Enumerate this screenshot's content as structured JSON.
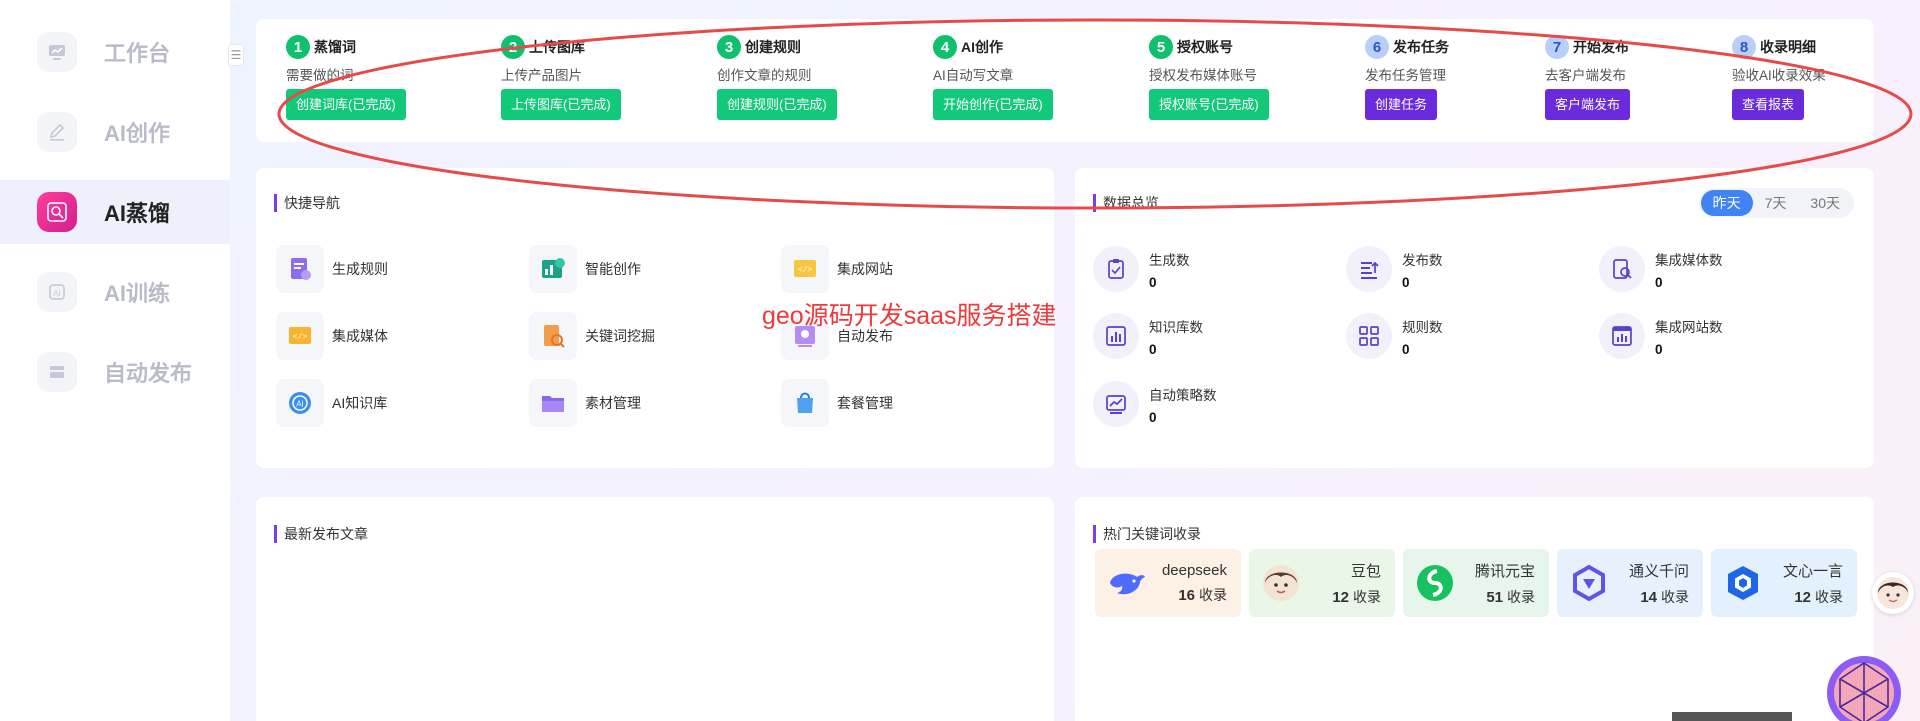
{
  "sidebar": {
    "items": [
      {
        "label": "工作台",
        "icon": "dashboard-icon",
        "active": false
      },
      {
        "label": "AI创作",
        "icon": "pen-icon",
        "active": false
      },
      {
        "label": "AI蒸馏",
        "icon": "search-distill-icon",
        "active": true
      },
      {
        "label": "AI训练",
        "icon": "ai-train-icon",
        "active": false
      },
      {
        "label": "自动发布",
        "icon": "publish-stack-icon",
        "active": false
      }
    ],
    "collapse_glyph": "☰"
  },
  "steps": [
    {
      "num": "1",
      "title": "蒸馏词",
      "desc": "需要做的词",
      "button": "创建词库(已完成)",
      "state": "done"
    },
    {
      "num": "2",
      "title": "上传图库",
      "desc": "上传产品图片",
      "button": "上传图库(已完成)",
      "state": "done"
    },
    {
      "num": "3",
      "title": "创建规则",
      "desc": "创作文章的规则",
      "button": "创建规则(已完成)",
      "state": "done"
    },
    {
      "num": "4",
      "title": "AI创作",
      "desc": "AI自动写文章",
      "button": "开始创作(已完成)",
      "state": "done"
    },
    {
      "num": "5",
      "title": "授权账号",
      "desc": "授权发布媒体账号",
      "button": "授权账号(已完成)",
      "state": "done"
    },
    {
      "num": "6",
      "title": "发布任务",
      "desc": "发布任务管理",
      "button": "创建任务",
      "state": "todo"
    },
    {
      "num": "7",
      "title": "开始发布",
      "desc": "去客户端发布",
      "button": "客户端发布",
      "state": "todo"
    },
    {
      "num": "8",
      "title": "收录明细",
      "desc": "验收AI收录效果",
      "button": "查看报表",
      "state": "todo"
    }
  ],
  "quick_nav": {
    "title": "快捷导航",
    "items": [
      {
        "label": "生成规则",
        "icon": "rule-doc-icon"
      },
      {
        "label": "智能创作",
        "icon": "smart-create-icon"
      },
      {
        "label": "集成网站",
        "icon": "website-code-icon"
      },
      {
        "label": "集成媒体",
        "icon": "media-code-icon"
      },
      {
        "label": "关键词挖掘",
        "icon": "keyword-search-icon"
      },
      {
        "label": "自动发布",
        "icon": "auto-publish-icon"
      },
      {
        "label": "AI知识库",
        "icon": "ai-knowledge-icon"
      },
      {
        "label": "素材管理",
        "icon": "folder-icon"
      },
      {
        "label": "套餐管理",
        "icon": "package-bag-icon"
      }
    ],
    "watermark": "geo源码开发saas服务搭建"
  },
  "overview": {
    "title": "数据总览",
    "ranges": [
      "昨天",
      "7天",
      "30天"
    ],
    "active_range": "昨天",
    "stats": [
      {
        "label": "生成数",
        "value": "0",
        "icon": "clipboard-icon"
      },
      {
        "label": "发布数",
        "value": "0",
        "icon": "publish-list-icon"
      },
      {
        "label": "集成媒体数",
        "value": "0",
        "icon": "media-search-icon"
      },
      {
        "label": "知识库数",
        "value": "0",
        "icon": "bar-chart-icon"
      },
      {
        "label": "规则数",
        "value": "0",
        "icon": "grid-icon"
      },
      {
        "label": "集成网站数",
        "value": "0",
        "icon": "web-chart-icon"
      },
      {
        "label": "自动策略数",
        "value": "0",
        "icon": "trend-icon"
      }
    ]
  },
  "latest": {
    "title": "最新发布文章"
  },
  "hot_keywords": {
    "title": "热门关键词收录",
    "suffix": "收录",
    "items": [
      {
        "name": "deepseek",
        "count": "16",
        "bg": "#fdf0e4",
        "icon": "deepseek-whale-icon"
      },
      {
        "name": "豆包",
        "count": "12",
        "bg": "#eaf6e8",
        "icon": "doubao-avatar-icon"
      },
      {
        "name": "腾讯元宝",
        "count": "51",
        "bg": "#e6f6ec",
        "icon": "yuanbao-icon"
      },
      {
        "name": "通义千问",
        "count": "14",
        "bg": "#e7f1fd",
        "icon": "qianwen-icon"
      },
      {
        "name": "文心一言",
        "count": "12",
        "bg": "#e3f0fd",
        "icon": "wenxin-icon"
      }
    ]
  },
  "colors": {
    "done": "#12c97a",
    "todo_button": "#6a2bdc",
    "accent": "#7b3cf0",
    "annotation": "#e84a4a",
    "range_active": "#3f84f5"
  }
}
